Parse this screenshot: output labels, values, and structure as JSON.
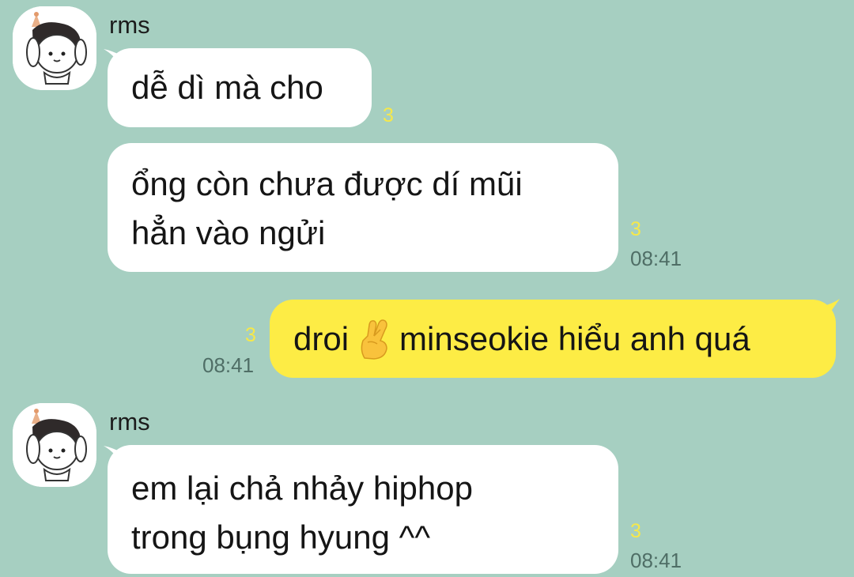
{
  "messages": [
    {
      "sender": "rms",
      "lines": [
        "dễ dì mà cho"
      ],
      "unread": "3",
      "time": ""
    },
    {
      "lines": [
        "ổng còn chưa được dí mũi",
        "hẳn vào ngửi"
      ],
      "unread": "3",
      "time": "08:41"
    },
    {
      "outgoing": true,
      "before_emoji": "droi",
      "emoji": "crossed-fingers",
      "after_emoji": "minseokie hiểu anh quá",
      "unread": "3",
      "time": "08:41"
    },
    {
      "sender": "rms",
      "lines": [
        "em lại chả nhảy hiphop",
        "trong bụng hyung ^^"
      ],
      "unread": "3",
      "time": "08:41"
    }
  ],
  "colors": {
    "background": "#a6cfc1",
    "incoming_bubble": "#ffffff",
    "outgoing_bubble": "#fdec45",
    "unread_count": "#f6e84a",
    "timestamp": "#4f6e66"
  },
  "icons": {
    "avatar": "cartoon-boy-avatar",
    "emoji": "crossed-fingers-emoji"
  }
}
